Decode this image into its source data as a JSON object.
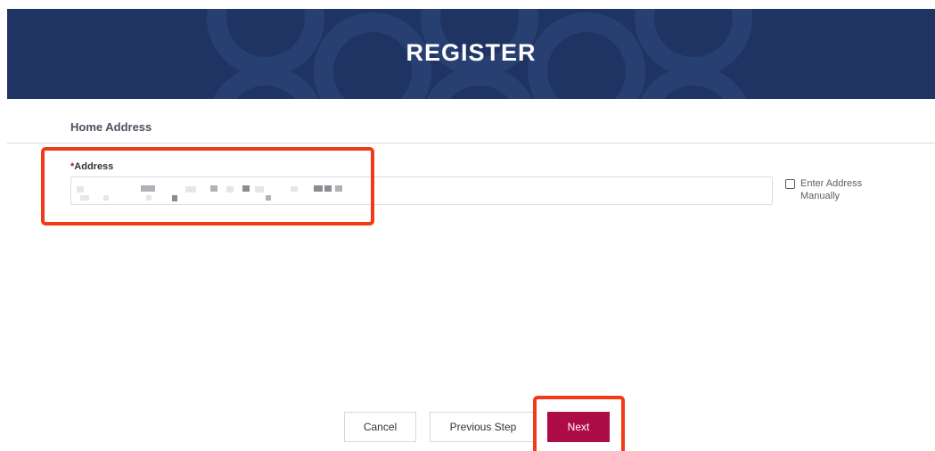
{
  "header": {
    "title": "REGISTER",
    "background_color": "#1f3462"
  },
  "section": {
    "title": "Home Address"
  },
  "address_field": {
    "required_marker": "*",
    "label": "Address",
    "value": ""
  },
  "manual_entry": {
    "label": "Enter Address Manually",
    "checked": false
  },
  "buttons": {
    "cancel": "Cancel",
    "previous": "Previous Step",
    "next": "Next"
  },
  "colors": {
    "accent": "#ae0c46",
    "highlight": "#f23a16"
  }
}
